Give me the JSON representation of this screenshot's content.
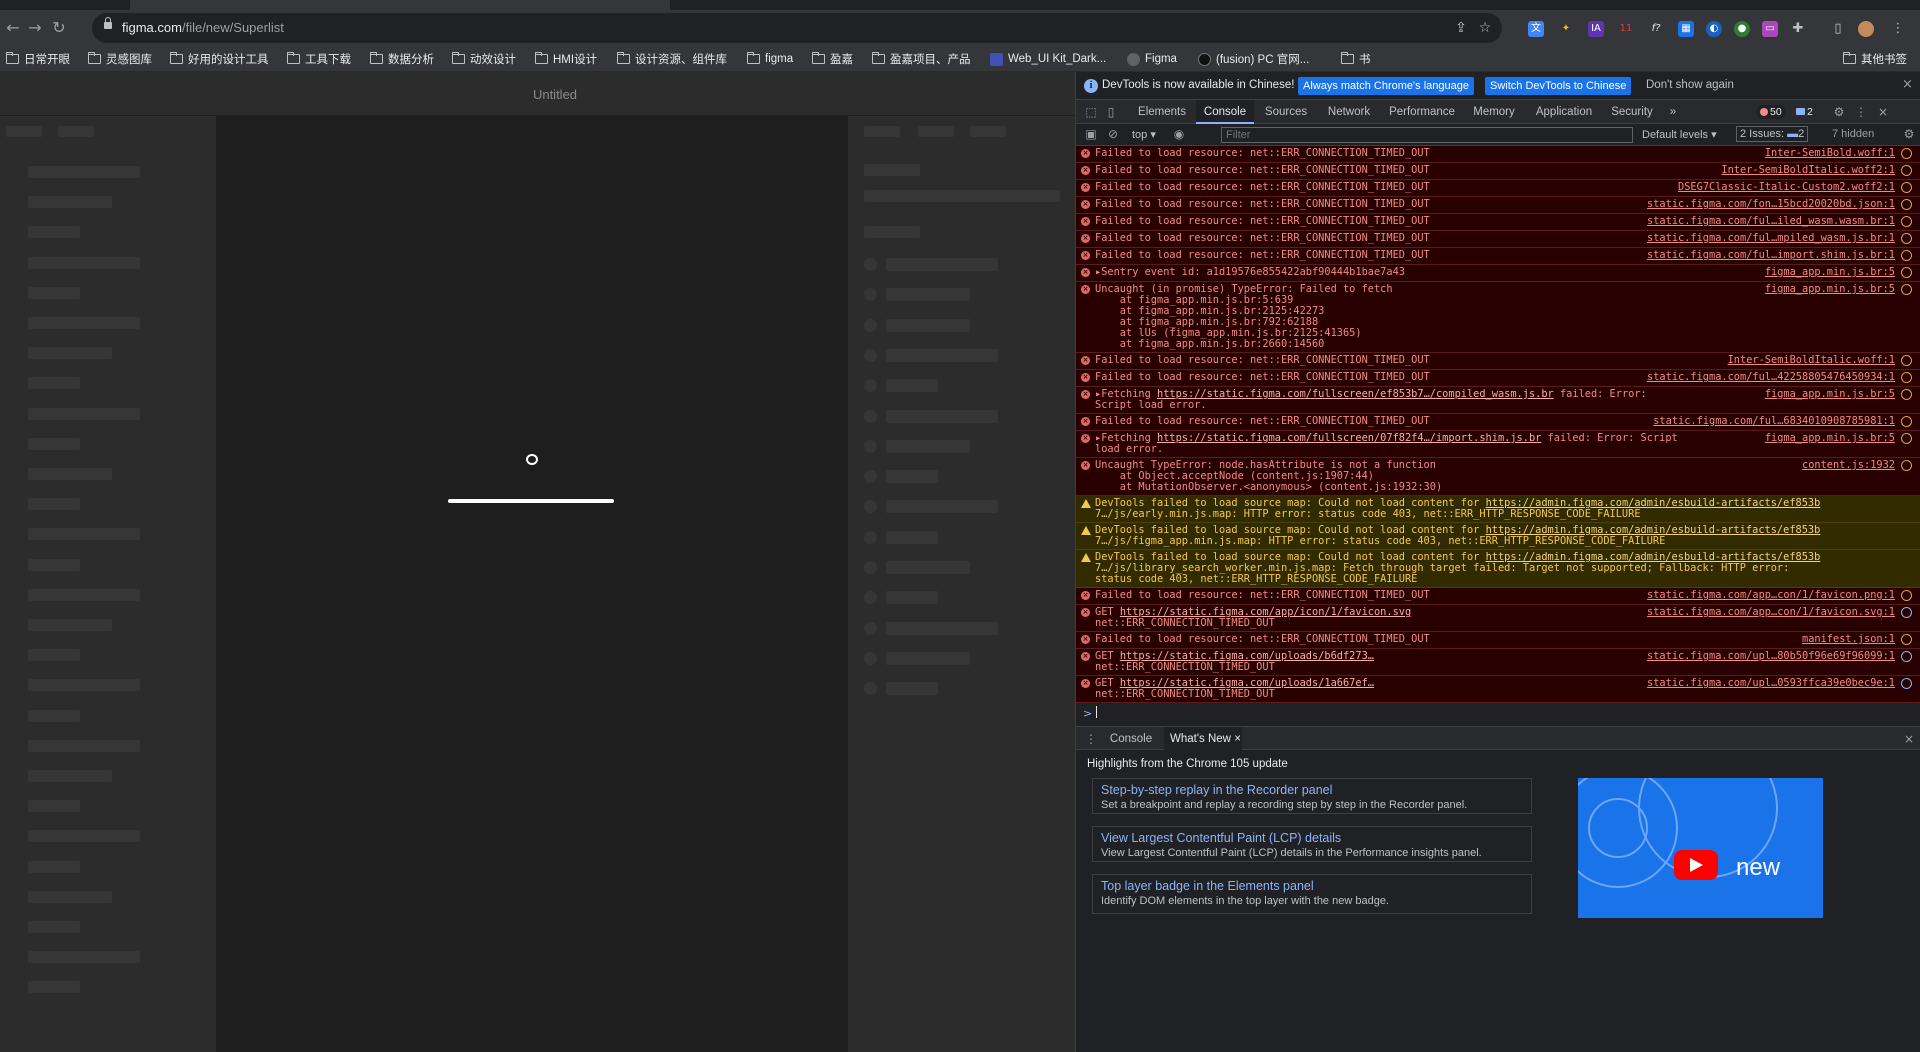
{
  "browser": {
    "url_host": "figma.com",
    "url_path": "/file/new/Superlist",
    "bookmarks": [
      "日常开眼",
      "灵感图库",
      "好用的设计工具",
      "工具下载",
      "数据分析",
      "动效设计",
      "HMI设计",
      "设计资源、组件库",
      "figma",
      "盈嘉",
      "盈嘉项目、产品",
      "Web_UI Kit_Dark...",
      "Figma",
      "(fusion) PC 官网...",
      "书"
    ],
    "other_bookmarks": "其他书签",
    "extension_badge": "11"
  },
  "figma": {
    "title": "Untitled",
    "help_label": "?"
  },
  "devtools": {
    "infobar": {
      "message": "DevTools is now available in Chinese!",
      "btn_match": "Always match Chrome's language",
      "btn_switch": "Switch DevTools to Chinese",
      "dont_show": "Don't show again"
    },
    "tabs": [
      "Elements",
      "Console",
      "Sources",
      "Network",
      "Performance",
      "Memory",
      "Application",
      "Security"
    ],
    "active_tab": "Console",
    "more_tabs": "»",
    "error_count": "50",
    "message_count": "2",
    "filter": {
      "context": "top",
      "placeholder": "Filter",
      "levels": "Default levels",
      "issues_label": "2 Issues:",
      "issues_count": "2",
      "hidden": "7 hidden"
    },
    "console_rows": [
      {
        "type": "err",
        "lines": [
          "Failed to load resource: net::ERR_CONNECTION_TIMED_OUT"
        ],
        "source": "Inter-SemiBold.woff:1"
      },
      {
        "type": "err",
        "lines": [
          "Failed to load resource: net::ERR_CONNECTION_TIMED_OUT"
        ],
        "source": "Inter-SemiBoldItalic.woff2:1"
      },
      {
        "type": "err",
        "lines": [
          "Failed to load resource: net::ERR_CONNECTION_TIMED_OUT"
        ],
        "source": "DSEG7Classic-Italic-Custom2.woff2:1"
      },
      {
        "type": "err",
        "lines": [
          "Failed to load resource: net::ERR_CONNECTION_TIMED_OUT"
        ],
        "source": "static.figma.com/fon…15bcd20020bd.json:1"
      },
      {
        "type": "err",
        "lines": [
          "Failed to load resource: net::ERR_CONNECTION_TIMED_OUT"
        ],
        "source": "static.figma.com/ful…iled_wasm.wasm.br:1"
      },
      {
        "type": "err",
        "lines": [
          "Failed to load resource: net::ERR_CONNECTION_TIMED_OUT"
        ],
        "source": "static.figma.com/ful…mpiled_wasm.js.br:1"
      },
      {
        "type": "err",
        "lines": [
          "Failed to load resource: net::ERR_CONNECTION_TIMED_OUT"
        ],
        "source": "static.figma.com/ful…import.shim.js.br:1"
      },
      {
        "type": "err",
        "lines": [
          "▸Sentry event id: a1d19576e855422abf90444b1bae7a43"
        ],
        "source": "figma_app.min.js.br:5"
      },
      {
        "type": "err",
        "lines": [
          "Uncaught (in promise) TypeError: Failed to fetch",
          "    at figma_app.min.js.br:5:639",
          "    at figma_app.min.js.br:2125:42273",
          "    at figma_app.min.js.br:792:62188",
          "    at lUs (figma_app.min.js.br:2125:41365)",
          "    at figma_app.min.js.br:2660:14560"
        ],
        "source": "figma_app.min.js.br:5"
      },
      {
        "type": "err",
        "lines": [
          "Failed to load resource: net::ERR_CONNECTION_TIMED_OUT"
        ],
        "source": "Inter-SemiBoldItalic.woff:1"
      },
      {
        "type": "err",
        "lines": [
          "Failed to load resource: net::ERR_CONNECTION_TIMED_OUT"
        ],
        "source": "static.figma.com/ful…42258805476450934:1"
      },
      {
        "type": "err",
        "lines": [
          "▸Fetching https://static.figma.com/fullscreen/ef853b7…/compiled_wasm.js.br failed: Error:",
          "Script load error."
        ],
        "source": "figma_app.min.js.br:5"
      },
      {
        "type": "err",
        "lines": [
          "Failed to load resource: net::ERR_CONNECTION_TIMED_OUT"
        ],
        "source": "static.figma.com/ful…6834010908785981:1"
      },
      {
        "type": "err",
        "lines": [
          "▸Fetching https://static.figma.com/fullscreen/07f82f4…/import.shim.js.br failed: Error: Script",
          "load error."
        ],
        "source": "figma_app.min.js.br:5"
      },
      {
        "type": "err",
        "lines": [
          "Uncaught TypeError: node.hasAttribute is not a function",
          "    at Object.acceptNode (content.js:1907:44)",
          "    at MutationObserver.<anonymous> (content.js:1932:30)"
        ],
        "source": "content.js:1932"
      },
      {
        "type": "warn",
        "lines": [
          "DevTools failed to load source map: Could not load content for https://admin.figma.com/admin/esbuild-artifacts/ef853b",
          "7…/js/early.min.js.map: HTTP error: status code 403, net::ERR_HTTP_RESPONSE_CODE_FAILURE"
        ],
        "source": ""
      },
      {
        "type": "warn",
        "lines": [
          "DevTools failed to load source map: Could not load content for https://admin.figma.com/admin/esbuild-artifacts/ef853b",
          "7…/js/figma_app.min.js.map: HTTP error: status code 403, net::ERR_HTTP_RESPONSE_CODE_FAILURE"
        ],
        "source": ""
      },
      {
        "type": "warn",
        "lines": [
          "DevTools failed to load source map: Could not load content for https://admin.figma.com/admin/esbuild-artifacts/ef853b",
          "7…/js/library_search_worker.min.js.map: Fetch through target failed: Target not supported; Fallback: HTTP error:",
          "status code 403, net::ERR_HTTP_RESPONSE_CODE_FAILURE"
        ],
        "source": ""
      },
      {
        "type": "err",
        "lines": [
          "Failed to load resource: net::ERR_CONNECTION_TIMED_OUT"
        ],
        "source": "static.figma.com/app…con/1/favicon.png:1"
      },
      {
        "type": "err",
        "lines": [
          "GET https://static.figma.com/app/icon/1/favicon.svg",
          "net::ERR_CONNECTION_TIMED_OUT"
        ],
        "source": "static.figma.com/app…con/1/favicon.svg:1"
      },
      {
        "type": "err",
        "lines": [
          "Failed to load resource: net::ERR_CONNECTION_TIMED_OUT"
        ],
        "source": "manifest.json:1"
      },
      {
        "type": "err",
        "lines": [
          "GET https://static.figma.com/uploads/b6df273…",
          "net::ERR_CONNECTION_TIMED_OUT"
        ],
        "source": "static.figma.com/upl…80b50f96e69f96099:1"
      },
      {
        "type": "err",
        "lines": [
          "GET https://static.figma.com/uploads/1a667ef…",
          "net::ERR_CONNECTION_TIMED_OUT"
        ],
        "source": "static.figma.com/upl…0593ffca39e0bec9e:1"
      }
    ],
    "prompt_symbol": ">",
    "drawer": {
      "tabs": [
        "Console",
        "What's New"
      ],
      "active": "What's New",
      "close": "×",
      "highlights": "Highlights from the Chrome 105 update",
      "cards": [
        {
          "title": "Step-by-step replay in the Recorder panel",
          "desc": "Set a breakpoint and replay a recording step by step in the Recorder panel."
        },
        {
          "title": "View Largest Contentful Paint (LCP) details",
          "desc": "View Largest Contentful Paint (LCP) details in the Performance insights panel."
        },
        {
          "title": "Top layer badge in the Elements panel",
          "desc": "Identify DOM elements in the top layer with the new badge."
        }
      ],
      "promo_text": "new"
    }
  }
}
